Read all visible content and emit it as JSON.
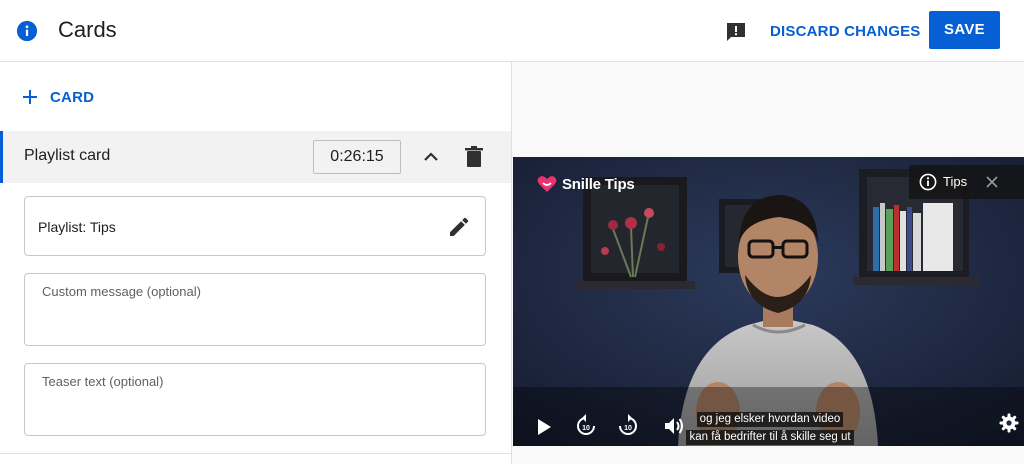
{
  "header": {
    "title": "Cards",
    "discard_label": "DISCARD CHANGES",
    "save_label": "SAVE",
    "info_icon": "info-icon",
    "feedback_icon": "feedback-icon"
  },
  "editor": {
    "add_card_label": "CARD",
    "card": {
      "title": "Playlist card",
      "time": "0:26:15",
      "playlist_value": "Playlist: Tips",
      "custom_message_placeholder": "Custom message (optional)",
      "teaser_placeholder": "Teaser text (optional)"
    }
  },
  "video": {
    "brand": "Snille Tips",
    "teaser_chip_label": "Tips",
    "captions": [
      "og jeg elsker hvordan video",
      "kan få bedrifter til å skille seg ut"
    ],
    "rewind_label": "10",
    "forward_label": "10"
  },
  "colors": {
    "accent": "#065fd4",
    "brand_heart": "#e8336f"
  }
}
